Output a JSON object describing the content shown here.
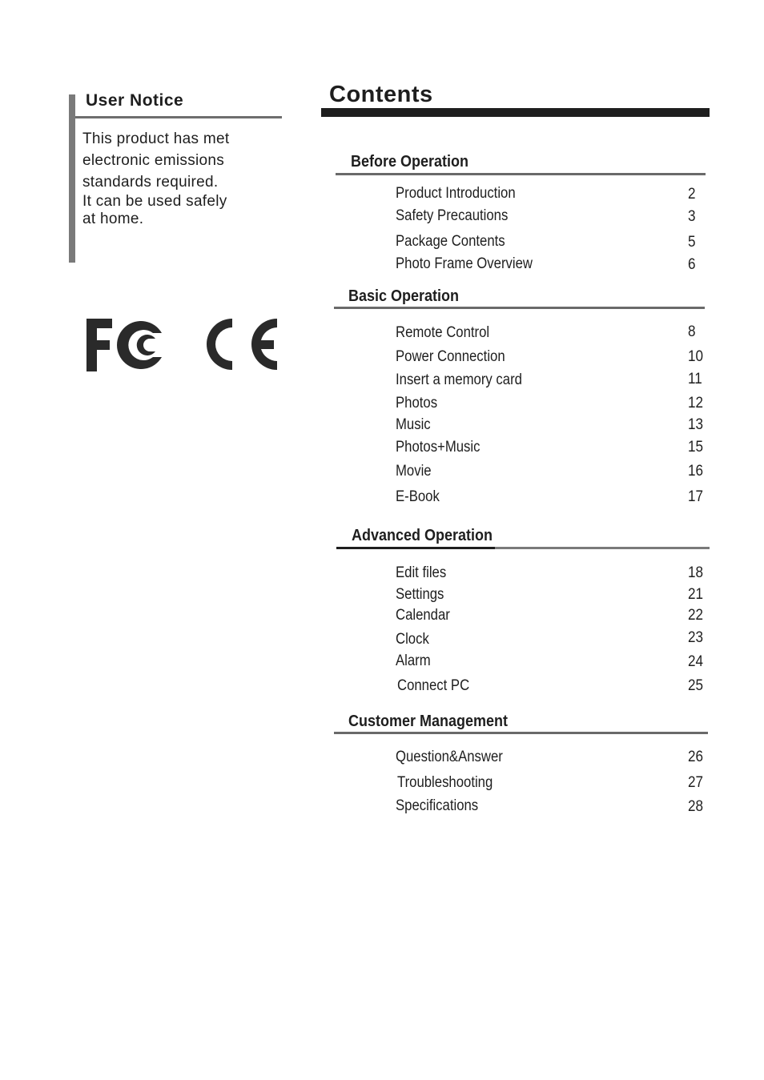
{
  "user_notice": {
    "title": "User Notice",
    "lines": [
      "This product has met",
      "electronic emissions",
      "standards required.",
      "It can be used safely",
      "at home."
    ]
  },
  "logos": [
    {
      "name": "fcc-logo",
      "label": "FC"
    },
    {
      "name": "ce-logo",
      "label": "CE"
    }
  ],
  "contents": {
    "title": "Contents",
    "sections": [
      {
        "title": "Before Operation",
        "items": [
          {
            "label": "Product Introduction",
            "page": "2"
          },
          {
            "label": "Safety Precautions",
            "page": "3"
          },
          {
            "label": "Package Contents",
            "page": "5"
          },
          {
            "label": "Photo Frame Overview",
            "page": "6"
          }
        ]
      },
      {
        "title": "Basic Operation",
        "items": [
          {
            "label": "Remote Control",
            "page": "8"
          },
          {
            "label": "Power Connection",
            "page": "10"
          },
          {
            "label": "Insert a  memory card",
            "page": "11"
          },
          {
            "label": "Photos",
            "page": "12"
          },
          {
            "label": "Music",
            "page": "13"
          },
          {
            "label": "Photos+Music",
            "page": "15"
          },
          {
            "label": "Movie",
            "page": "16"
          },
          {
            "label": "E-Book",
            "page": "17"
          }
        ]
      },
      {
        "title": "Advanced Operation",
        "items": [
          {
            "label": "Edit files",
            "page": "18"
          },
          {
            "label": "Settings",
            "page": "21"
          },
          {
            "label": "Calendar",
            "page": "22"
          },
          {
            "label": "Clock",
            "page": "23"
          },
          {
            "label": "Alarm",
            "page": "24"
          },
          {
            "label": "Connect PC",
            "page": "25"
          }
        ]
      },
      {
        "title": "Customer Management",
        "items": [
          {
            "label": "Question&Answer",
            "page": "26"
          },
          {
            "label": "Troubleshooting",
            "page": "27"
          },
          {
            "label": "Specifications",
            "page": "28"
          }
        ]
      }
    ]
  }
}
